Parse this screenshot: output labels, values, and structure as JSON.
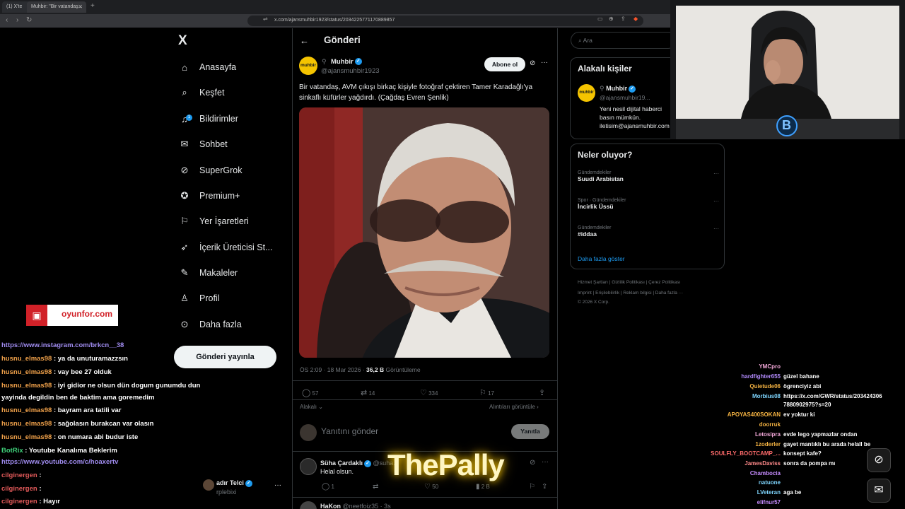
{
  "browser": {
    "tabs": [
      {
        "label": "(1) X'te"
      },
      {
        "label": "Muhbir: \"Bir vatandaş..."
      }
    ],
    "new_tab": "+",
    "url": "x.com/ajansmuhbir1923/status/2034225771170889857"
  },
  "nav": {
    "logo": "X",
    "items": [
      {
        "label": "Anasayfa",
        "icon": "home-icon"
      },
      {
        "label": "Keşfet",
        "icon": "search-icon"
      },
      {
        "label": "Bildirimler",
        "icon": "bell-icon",
        "badge": "1"
      },
      {
        "label": "Sohbet",
        "icon": "mail-icon"
      },
      {
        "label": "SuperGrok",
        "icon": "grok-icon"
      },
      {
        "label": "Premium+",
        "icon": "premium-icon"
      },
      {
        "label": "Yer İşaretleri",
        "icon": "bookmark-icon"
      },
      {
        "label": "İçerik Üreticisi St...",
        "icon": "rocket-icon"
      },
      {
        "label": "Makaleler",
        "icon": "article-icon"
      },
      {
        "label": "Profil",
        "icon": "profile-icon"
      },
      {
        "label": "Daha fazla",
        "icon": "more-icon"
      }
    ],
    "post_button": "Gönderi yayınla",
    "account": {
      "name": "adır Telci",
      "handle": "rplebixi"
    }
  },
  "post": {
    "header": "Gönderi",
    "author": "Muhbir",
    "handle": "@ajansmuhbir1923",
    "avatar_text": "muhbir",
    "follow": "Abone ol",
    "text": "Bir vatandaş, AVM çıkışı birkaç kişiyle fotoğraf çektiren Tamer Karadağlı'ya sinkaflı küfürler yağdırdı. (Çağdaş Evren Şenlik)",
    "time": "ÖS 2:09 · 18 Mar 2026 ·",
    "views": "36,2 B",
    "views_label": "Görüntüleme",
    "replies": "57",
    "reposts": "14",
    "likes": "334",
    "bookmarks": "17",
    "sort_label": "Alakalı",
    "quotes_link": "Alıntıları görüntüle",
    "reply_placeholder": "Yanıtını gönder",
    "reply_button": "Yanıtla"
  },
  "reply": {
    "name": "Süha Çardaklı",
    "handle": "@suha...",
    "text": "Helal olsun.",
    "replies": "1",
    "likes": "50",
    "views": "2 B",
    "next_name": "HaKon",
    "next_handle": "@neetfoiz35 · 3s"
  },
  "right": {
    "search_placeholder": "Ara",
    "related_title": "Alakalı kişiler",
    "related": {
      "name": "Muhbir",
      "handle": "@ajansmuhbir19...",
      "bio": "Yeni nesil dijital haberci basın mümkün. iletisim@ajansmuhbir.com"
    },
    "trends_title": "Neler oluyor?",
    "trends": [
      {
        "category": "Gündemdekiler",
        "name": "Suudi Arabistan"
      },
      {
        "category": "Spor · Gündemdekiler",
        "name": "İncirlik Üssü"
      },
      {
        "category": "Gündemdekiler",
        "name": "#iddaa"
      }
    ],
    "show_more": "Daha fazla göster",
    "footer1": "Hizmet Şartları  |  Gizlilik Politikası  |  Çerez Politikası",
    "footer2": "Imprint  |  Erişilebilirlik  |  Reklam bilgisi  |  Daha fazla ···",
    "footer3": "© 2026 X Corp."
  },
  "overlay": {
    "brand": "oyunfor.com",
    "watermark": "ThePally",
    "webcam_badge": "B",
    "left_chat": [
      {
        "user": "",
        "text": "https://www.instagram.com/brkcn__38",
        "link": true
      },
      {
        "user": "husnu_elmas98",
        "text": ": ya da unuturamazzsın"
      },
      {
        "user": "husnu_elmas98",
        "text": ": vay bee 27 olduk"
      },
      {
        "user": "husnu_elmas98",
        "text": ": iyi gidior ne olsun dün dogum gunumdu dun"
      },
      {
        "user": "",
        "text": "yayinda degildin ben de baktim ama goremedim"
      },
      {
        "user": "husnu_elmas98",
        "text": ": bayram ara tatili var"
      },
      {
        "user": "husnu_elmas98",
        "text": ": sağolasın burakcan var olasın"
      },
      {
        "user": "husnu_elmas98",
        "text": ": on numara abi budur iste"
      },
      {
        "user": "BotRix",
        "text": ": Youtube Kanalıma Beklerim"
      },
      {
        "user": "",
        "text": "https://www.youtube.com/c/hoaxertv",
        "link": true
      },
      {
        "user": "cilginergen",
        "text": ":"
      },
      {
        "user": "cilginergen",
        "text": ":"
      },
      {
        "user": "cilginergen",
        "text": ": Hayır"
      }
    ],
    "right_chat": [
      {
        "user": "YMCpro",
        "text": "",
        "color": "#f2a7d8"
      },
      {
        "user": "hardfighter655",
        "text": "güzel bahane",
        "color": "#b48cff"
      },
      {
        "user": "Quietude06",
        "text": "ögrenciyiz abi",
        "color": "#f5b342"
      },
      {
        "user": "Morbius08",
        "text": "https://x.com/GWR/status/203424306",
        "color": "#7fd6ff"
      },
      {
        "user": "",
        "text": "7880902975?s=20",
        "color": "#ffffff"
      },
      {
        "user": "APOYAS400SOKAN",
        "text": "ev yoktur ki",
        "color": "#f5b342"
      },
      {
        "user": "doorruk",
        "text": "",
        "color": "#f5b342"
      },
      {
        "user": "Letosipra",
        "text": "evde lego yapmazlar ondan",
        "color": "#f2a7d8"
      },
      {
        "user": "1zoderler",
        "text": "gayet mantıklı bu arada helall be",
        "color": "#f5b342"
      },
      {
        "user": "SOULFLY_BOOTCAMP_...",
        "text": "konsept kafe?",
        "color": "#ff6b6b"
      },
      {
        "user": "JamesDaviss",
        "text": "sonra da pompa mı",
        "color": "#ff8a8a"
      },
      {
        "user": "Chambocia",
        "text": "",
        "color": "#c68cff"
      },
      {
        "user": "natuone",
        "text": "",
        "color": "#7fd6ff"
      },
      {
        "user": "LVeteran",
        "text": "aga be",
        "color": "#7fd6ff"
      },
      {
        "user": "elifnur57",
        "text": "",
        "color": "#c68cff"
      }
    ]
  }
}
